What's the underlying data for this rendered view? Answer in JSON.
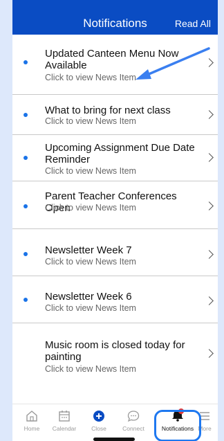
{
  "header": {
    "title": "Notifications",
    "read_all": "Read All"
  },
  "notifications": [
    {
      "title": "Updated Canteen Menu Now Available",
      "subtitle": "Click to view News Item",
      "unread": true
    },
    {
      "title": "What to bring for next class",
      "subtitle": "Click to view News Item",
      "unread": true
    },
    {
      "title": "Upcoming Assignment Due Date Reminder",
      "subtitle": "Click to view News Item",
      "unread": true
    },
    {
      "title": "Parent Teacher Conferences Open",
      "subtitle": "Click to view News Item",
      "unread": true
    },
    {
      "title": "Newsletter Week 7",
      "subtitle": "Click to view News Item",
      "unread": true
    },
    {
      "title": "Newsletter Week 6",
      "subtitle": "Click to view News Item",
      "unread": true
    },
    {
      "title": "Music room is closed today for painting",
      "subtitle": "Click to view News Item",
      "unread": false
    }
  ],
  "tabbar": {
    "items": [
      {
        "label": "Home",
        "icon": "home-icon"
      },
      {
        "label": "Calendar",
        "icon": "calendar-icon"
      },
      {
        "label": "Close",
        "icon": "plus-circle-icon"
      },
      {
        "label": "Connect",
        "icon": "chat-bubble-icon"
      },
      {
        "label": "Notifications",
        "icon": "bell-icon",
        "active": true
      },
      {
        "label": "More",
        "icon": "menu-icon"
      }
    ]
  },
  "colors": {
    "header_bg": "#0a4cc3",
    "accent": "#1e78f0",
    "unread_dot": "#1a73e8",
    "badge": "#e53935"
  }
}
